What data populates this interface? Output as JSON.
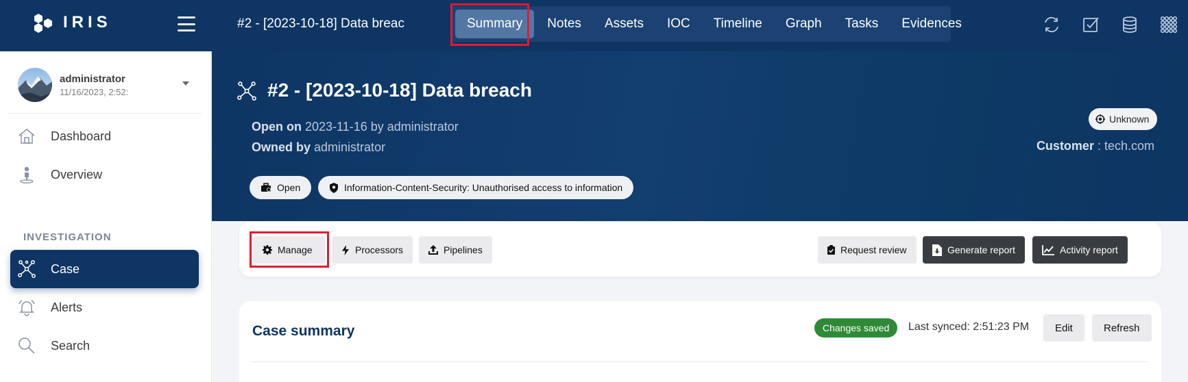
{
  "app": {
    "logo_text": "IRIS"
  },
  "header": {
    "case_crumb": "#2 - [2023-10-18] Data breac",
    "tabs": [
      {
        "label": "Summary",
        "active": true
      },
      {
        "label": "Notes"
      },
      {
        "label": "Assets"
      },
      {
        "label": "IOC"
      },
      {
        "label": "Timeline"
      },
      {
        "label": "Graph"
      },
      {
        "label": "Tasks"
      },
      {
        "label": "Evidences"
      }
    ],
    "icons": [
      "sync-icon",
      "checklist-icon",
      "database-icon",
      "apps-grid-icon"
    ]
  },
  "sidebar": {
    "user": {
      "name": "administrator",
      "date": "11/16/2023, 2:52:"
    },
    "items": [
      {
        "label": "Dashboard",
        "icon": "home-icon"
      },
      {
        "label": "Overview",
        "icon": "location-person-icon"
      }
    ],
    "section_label": "INVESTIGATION",
    "section_items": [
      {
        "label": "Case",
        "icon": "network-icon",
        "active": true
      },
      {
        "label": "Alerts",
        "icon": "bell-icon"
      },
      {
        "label": "Search",
        "icon": "search-icon"
      }
    ]
  },
  "case": {
    "title": "#2 - [2023-10-18] Data breach",
    "open_label": "Open on",
    "open_value": "2023-11-16 by administrator",
    "owned_label": "Owned by",
    "owned_value": "administrator",
    "state_badge": "Unknown",
    "customer_label": "Customer",
    "customer_sep": " : ",
    "customer_value": "tech.com",
    "status_pill": "Open",
    "classification_pill": "Information-Content-Security: Unauthorised access to information"
  },
  "actions": {
    "manage": "Manage",
    "processors": "Processors",
    "pipelines": "Pipelines",
    "request_review": "Request review",
    "generate_report": "Generate report",
    "activity_report": "Activity report"
  },
  "summary": {
    "title": "Case summary",
    "saved_badge": "Changes saved",
    "last_synced": "Last synced: 2:51:23 PM",
    "edit": "Edit",
    "refresh": "Refresh"
  },
  "colors": {
    "primary": "#0e3563",
    "highlight": "#e5192f",
    "success": "#2e8a36",
    "dark_button": "#393d42"
  }
}
